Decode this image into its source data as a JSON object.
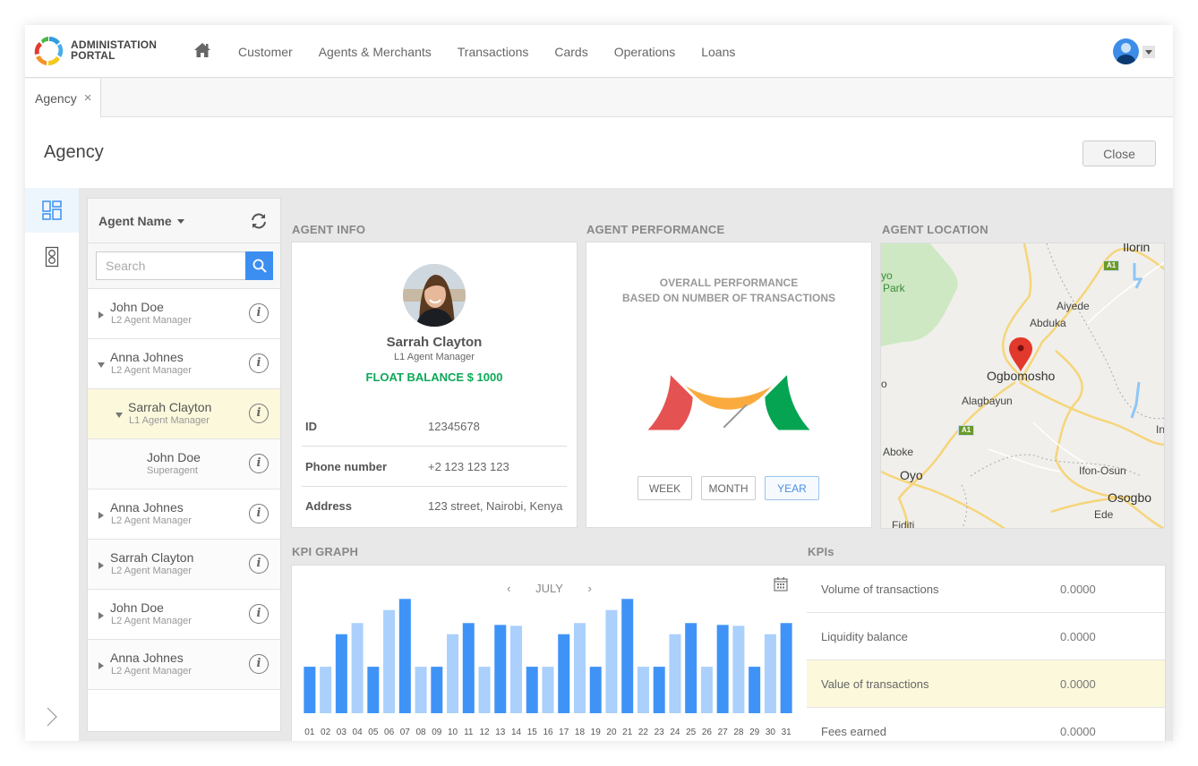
{
  "app": {
    "brand_line1": "ADMINISTATION",
    "brand_line2": "PORTAL"
  },
  "nav": {
    "items": [
      "Customer",
      "Agents & Merchants",
      "Transactions",
      "Cards",
      "Operations",
      "Loans"
    ]
  },
  "tabs": [
    {
      "label": "Agency",
      "close": "×"
    }
  ],
  "page": {
    "title": "Agency",
    "close_label": "Close"
  },
  "agent_list": {
    "sort_label": "Agent Name",
    "search_placeholder": "Search",
    "info_glyph": "i",
    "rows": [
      {
        "name": "John Doe",
        "role": "L2 Agent Manager",
        "expanded": false,
        "level": 0
      },
      {
        "name": "Anna Johnes",
        "role": "L2 Agent Manager",
        "expanded": true,
        "level": 0
      },
      {
        "name": "Sarrah Clayton",
        "role": "L1 Agent Manager",
        "expanded": true,
        "level": 1,
        "selected": true
      },
      {
        "name": "John Doe",
        "role": "Superagent",
        "expanded": null,
        "level": 2
      },
      {
        "name": "Anna Johnes",
        "role": "L2 Agent Manager",
        "expanded": false,
        "level": 0
      },
      {
        "name": "Sarrah Clayton",
        "role": "L2 Agent Manager",
        "expanded": false,
        "level": 0
      },
      {
        "name": "John Doe",
        "role": "L2 Agent Manager",
        "expanded": false,
        "level": 0
      },
      {
        "name": "Anna Johnes",
        "role": "L2 Agent Manager",
        "expanded": false,
        "level": 0
      }
    ]
  },
  "agent_info": {
    "section_label": "AGENT INFO",
    "name": "Sarrah Clayton",
    "role": "L1 Agent Manager",
    "float_balance": "FLOAT BALANCE $ 1000",
    "fields": [
      {
        "label": "ID",
        "value": "12345678"
      },
      {
        "label": "Phone number",
        "value": "+2 123 123 123"
      },
      {
        "label": "Address",
        "value": "123 street, Nairobi, Kenya"
      }
    ]
  },
  "agent_performance": {
    "section_label": "AGENT PERFORMANCE",
    "title_line1": "OVERALL PERFORMANCE",
    "title_line2": "BASED ON NUMBER OF TRANSACTIONS",
    "gauge_value_pct": 75,
    "gauge_colors": {
      "low": "#e55252",
      "mid": "#fbab3e",
      "high": "#04a452"
    },
    "periods": [
      {
        "label": "WEEK",
        "active": false
      },
      {
        "label": "MONTH",
        "active": false
      },
      {
        "label": "YEAR",
        "active": true
      }
    ]
  },
  "agent_location": {
    "section_label": "AGENT LOCATION",
    "places": [
      "Ilorin",
      "yo",
      "Park",
      "Aiyede",
      "Abduka",
      "Ogbomosho",
      "Alagbayun",
      "Aboke",
      "Oyo",
      "Ifon-Osun",
      "Osogbo",
      "Ede",
      "Fiditi",
      "In",
      "o"
    ],
    "road_badges": [
      "A1",
      "A1"
    ]
  },
  "kpi_graph": {
    "section_label": "KPI GRAPH",
    "month": "JULY",
    "prev": "‹",
    "next": "›"
  },
  "chart_data": {
    "type": "bar",
    "title": "JULY",
    "xlabel": "",
    "ylabel": "",
    "categories": [
      "01",
      "02",
      "03",
      "04",
      "05",
      "06",
      "07",
      "08",
      "09",
      "10",
      "11",
      "12",
      "13",
      "14",
      "15",
      "16",
      "17",
      "18",
      "19",
      "20",
      "21",
      "22",
      "23",
      "24",
      "25",
      "26",
      "27",
      "28",
      "29",
      "30",
      "31"
    ],
    "values": [
      50,
      50,
      85,
      97,
      50,
      111,
      123,
      50,
      50,
      85,
      97,
      50,
      95,
      94,
      50,
      50,
      85,
      97,
      50,
      111,
      123,
      50,
      50,
      85,
      97,
      50,
      95,
      94,
      50,
      85,
      97
    ],
    "ylim": [
      0,
      130
    ],
    "grid": false,
    "colors": {
      "dark": "#3f93f7",
      "light": "#aad0fb"
    },
    "pattern": [
      "dark",
      "light",
      "dark",
      "light",
      "dark",
      "light",
      "dark",
      "light",
      "dark",
      "light",
      "dark",
      "light",
      "dark",
      "light",
      "dark",
      "light",
      "dark",
      "light",
      "dark",
      "light",
      "dark",
      "light",
      "dark",
      "light",
      "dark",
      "light",
      "dark",
      "light",
      "dark",
      "light",
      "dark"
    ]
  },
  "kpis": {
    "section_label": "KPIs",
    "rows": [
      {
        "label": "Volume of transactions",
        "value": "0.0000"
      },
      {
        "label": "Liquidity balance",
        "value": "0.0000"
      },
      {
        "label": "Value of transactions",
        "value": "0.0000",
        "highlighted": true
      },
      {
        "label": "Fees earned",
        "value": "0.0000"
      }
    ]
  }
}
